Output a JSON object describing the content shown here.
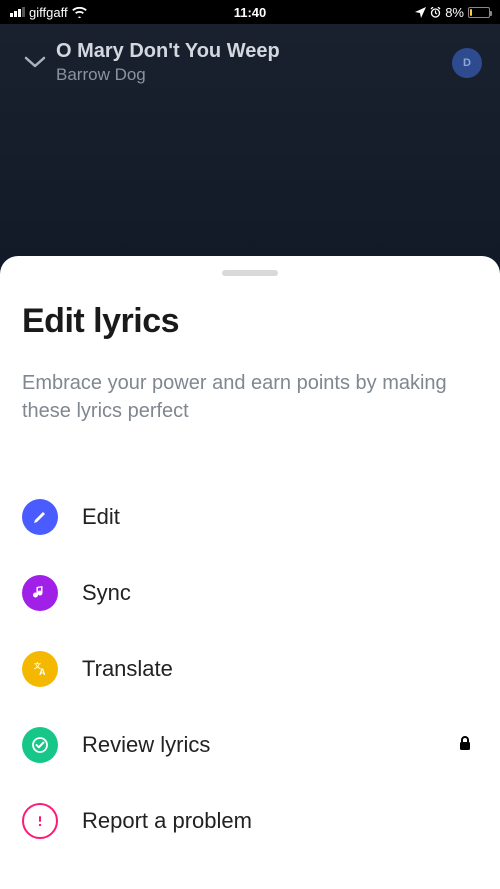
{
  "status": {
    "carrier": "giffgaff",
    "time": "11:40",
    "battery_pct": "8%"
  },
  "now_playing": {
    "title": "O Mary Don't You Weep",
    "artist": "Barrow Dog",
    "badge": "D"
  },
  "sheet": {
    "title": "Edit lyrics",
    "subtitle": "Embrace your power and earn points by making these lyrics perfect"
  },
  "menu": {
    "edit": "Edit",
    "sync": "Sync",
    "translate": "Translate",
    "review": "Review lyrics",
    "report": "Report a problem"
  }
}
